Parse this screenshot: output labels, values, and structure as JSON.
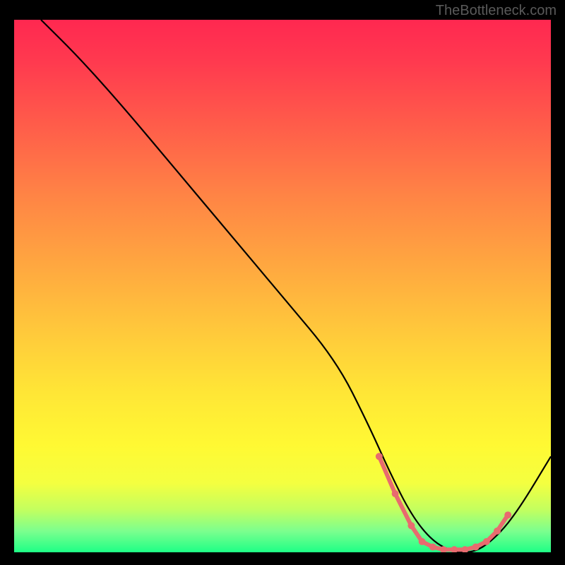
{
  "watermark": "TheBottleneck.com",
  "chart_data": {
    "type": "line",
    "title": "",
    "xlabel": "",
    "ylabel": "",
    "xlim": [
      0,
      100
    ],
    "ylim": [
      0,
      100
    ],
    "series": [
      {
        "name": "bottleneck-curve",
        "color": "#000000",
        "x": [
          5,
          12,
          20,
          30,
          40,
          50,
          60,
          66,
          70,
          74,
          78,
          82,
          86,
          90,
          94,
          100
        ],
        "y": [
          100,
          93,
          84,
          72,
          60,
          48,
          36,
          24,
          15,
          7,
          2,
          0,
          0,
          3,
          8,
          18
        ]
      }
    ],
    "highlight": {
      "name": "optimal-zone",
      "color": "#e86b6f",
      "points": [
        {
          "x": 68,
          "y": 18
        },
        {
          "x": 71,
          "y": 11
        },
        {
          "x": 74,
          "y": 5
        },
        {
          "x": 76,
          "y": 2
        },
        {
          "x": 78,
          "y": 1
        },
        {
          "x": 80,
          "y": 0.5
        },
        {
          "x": 82,
          "y": 0.5
        },
        {
          "x": 84,
          "y": 0.5
        },
        {
          "x": 86,
          "y": 1
        },
        {
          "x": 88,
          "y": 2
        },
        {
          "x": 90,
          "y": 4
        },
        {
          "x": 92,
          "y": 7
        }
      ]
    },
    "gradient": {
      "stops": [
        {
          "offset": 0,
          "color": "#ff2850"
        },
        {
          "offset": 50,
          "color": "#ffc83b"
        },
        {
          "offset": 85,
          "color": "#fdff34"
        },
        {
          "offset": 100,
          "color": "#1eff86"
        }
      ]
    }
  }
}
